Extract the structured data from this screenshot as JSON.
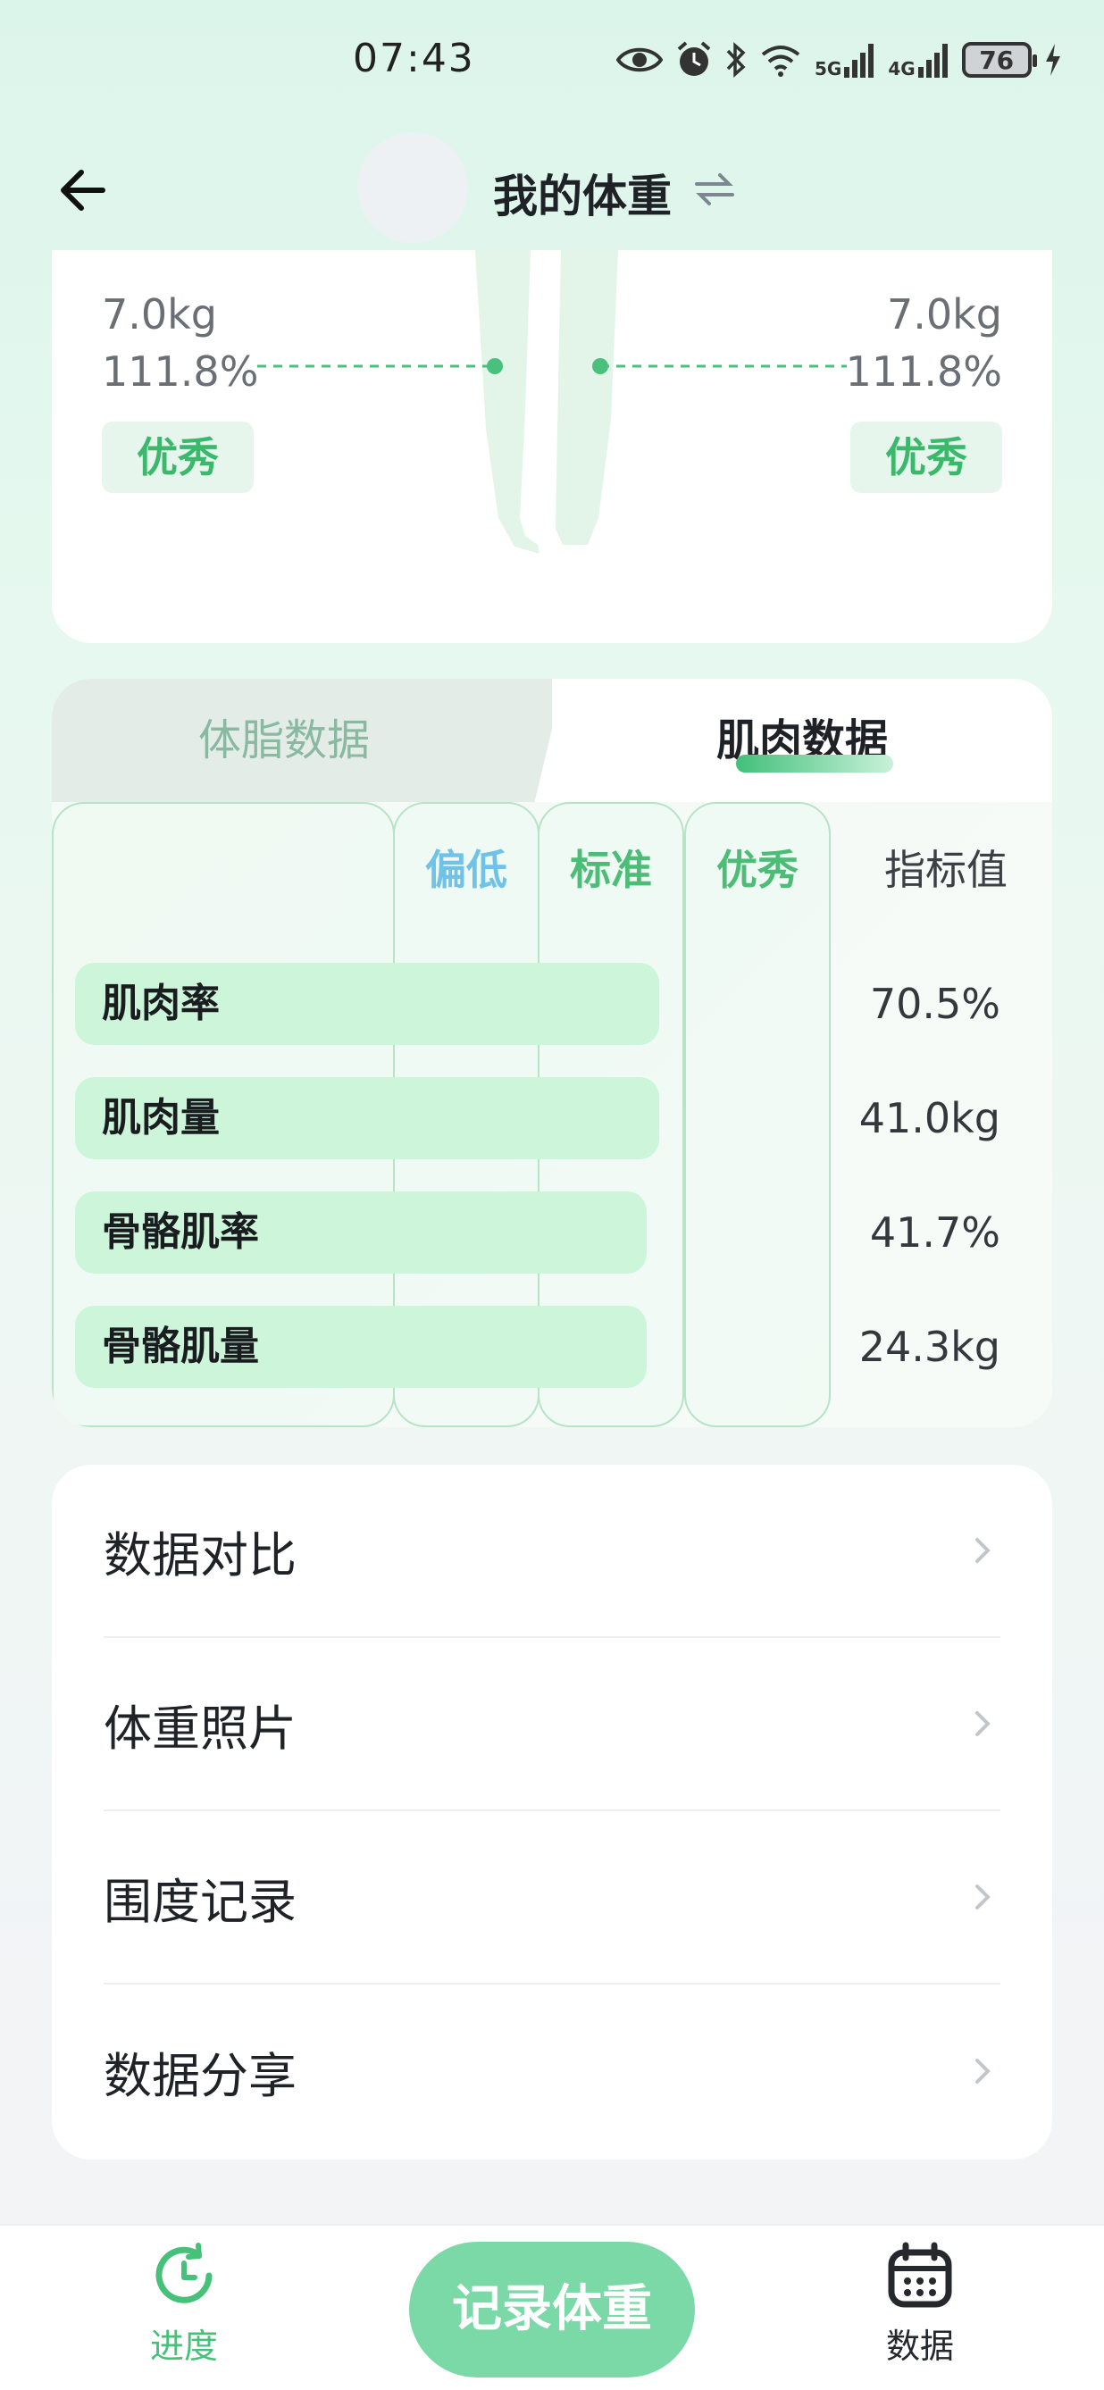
{
  "status_bar": {
    "time": "07:43",
    "battery": "76",
    "net1": "5G",
    "net2": "4G"
  },
  "header": {
    "title": "我的体重",
    "back_icon": "arrow-left-icon",
    "swap_icon": "swap-arrows-icon"
  },
  "figure": {
    "left": {
      "weight": "7.0kg",
      "percent": "111.8%",
      "grade": "优秀"
    },
    "right": {
      "weight": "7.0kg",
      "percent": "111.8%",
      "grade": "优秀"
    }
  },
  "tabs": {
    "fat": "体脂数据",
    "muscle": "肌肉数据",
    "active": "muscle"
  },
  "table": {
    "headers": {
      "low": "偏低",
      "standard": "标准",
      "excellent": "优秀",
      "value": "指标值"
    },
    "rows": [
      {
        "name": "肌肉率",
        "value": "70.5%",
        "level": "standard"
      },
      {
        "name": "肌肉量",
        "value": "41.0kg",
        "level": "standard"
      },
      {
        "name": "骨骼肌率",
        "value": "41.7%",
        "level": "standard"
      },
      {
        "name": "骨骼肌量",
        "value": "24.3kg",
        "level": "standard"
      }
    ]
  },
  "menu": {
    "items": [
      {
        "label": "数据对比"
      },
      {
        "label": "体重照片"
      },
      {
        "label": "围度记录"
      },
      {
        "label": "数据分享"
      }
    ]
  },
  "bottom_nav": {
    "progress": "进度",
    "record": "记录体重",
    "data": "数据"
  },
  "colors": {
    "accent_green": "#4cbc76",
    "low_blue": "#6fc3e8",
    "bar_green": "#cdf5da",
    "record_button": "#7ad9a6"
  }
}
